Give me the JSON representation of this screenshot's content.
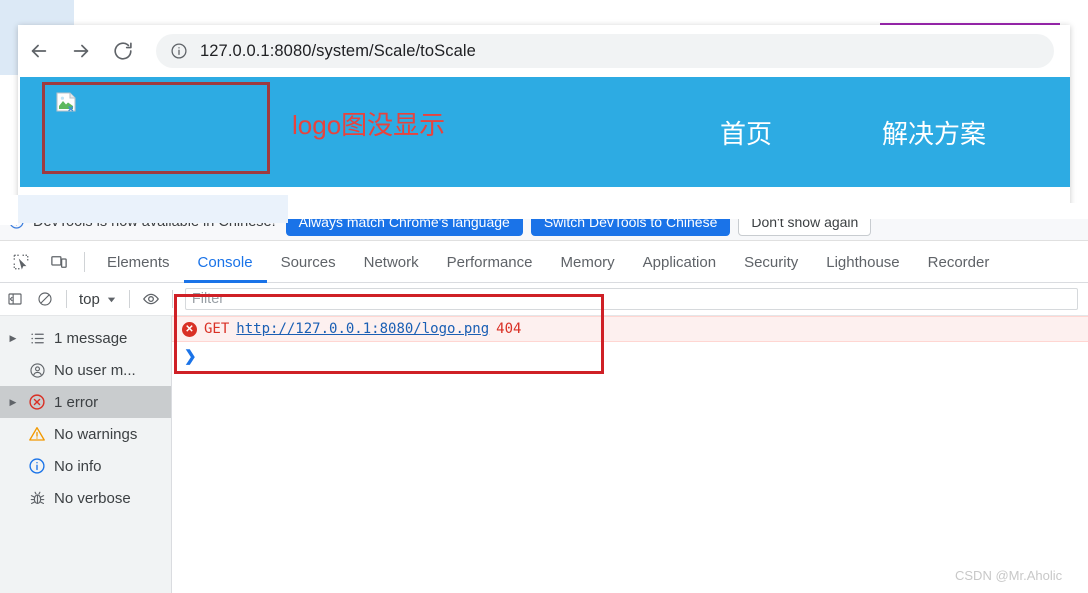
{
  "browser": {
    "back_label": "Back",
    "forward_label": "Forward",
    "reload_label": "Reload",
    "site_info_label": "View site information",
    "url": "127.0.0.1:8080/system/Scale/toScale"
  },
  "page": {
    "header_bg": "#2dabe3",
    "logo_alt": "broken-image",
    "annotation_text": "logo图没显示",
    "annotation_color": "#e8433d",
    "nav_links": [
      {
        "label": "首页"
      },
      {
        "label": "解决方案"
      }
    ]
  },
  "devtools": {
    "notification": {
      "message": "DevTools is now available in Chinese!",
      "buttons": [
        {
          "label": "Always match Chrome's language",
          "style": "primary"
        },
        {
          "label": "Switch DevTools to Chinese",
          "style": "primary"
        },
        {
          "label": "Don't show again",
          "style": "ghost"
        }
      ]
    },
    "tabs": [
      {
        "label": "Elements",
        "active": false
      },
      {
        "label": "Console",
        "active": true
      },
      {
        "label": "Sources",
        "active": false
      },
      {
        "label": "Network",
        "active": false
      },
      {
        "label": "Performance",
        "active": false
      },
      {
        "label": "Memory",
        "active": false
      },
      {
        "label": "Application",
        "active": false
      },
      {
        "label": "Security",
        "active": false
      },
      {
        "label": "Lighthouse",
        "active": false
      },
      {
        "label": "Recorder",
        "active": false
      }
    ],
    "console_toolbar": {
      "context": "top",
      "filter_placeholder": "Filter"
    },
    "sidebar": [
      {
        "label": "1 message",
        "icon": "list-icon",
        "expandable": true,
        "selected": false
      },
      {
        "label": "No user m...",
        "icon": "user-message-icon",
        "expandable": false,
        "selected": false
      },
      {
        "label": "1 error",
        "icon": "error-icon",
        "expandable": true,
        "selected": true
      },
      {
        "label": "No warnings",
        "icon": "warning-icon",
        "expandable": false,
        "selected": false
      },
      {
        "label": "No info",
        "icon": "info-icon",
        "expandable": false,
        "selected": false
      },
      {
        "label": "No verbose",
        "icon": "bug-icon",
        "expandable": false,
        "selected": false
      }
    ],
    "console_messages": [
      {
        "level": "error",
        "method": "GET",
        "url": "http://127.0.0.1:8080/logo.png",
        "status": "404"
      }
    ],
    "prompt_symbol": "❯"
  },
  "watermark": "CSDN @Mr.Aholic"
}
